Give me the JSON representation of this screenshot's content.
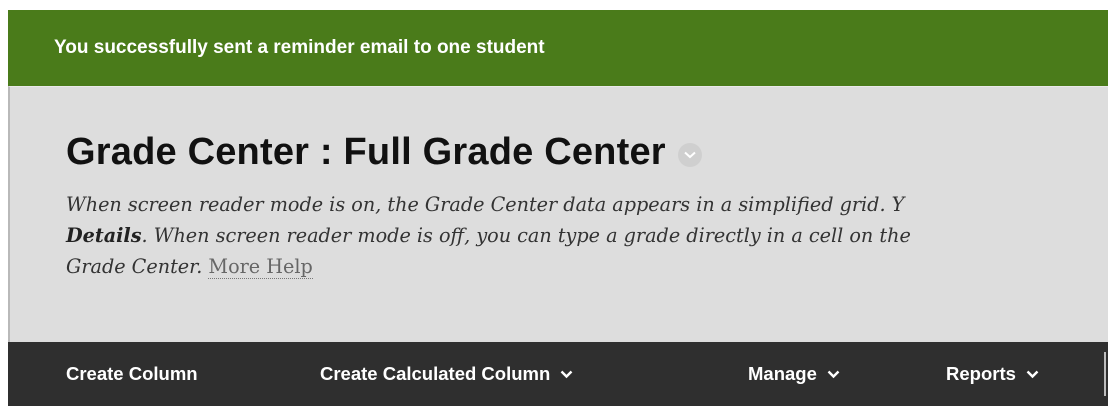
{
  "banner": {
    "message": "You successfully sent a reminder email to one student",
    "color": "#4a7b1a"
  },
  "header": {
    "title": "Grade Center : Full Grade Center",
    "title_menu_icon": "chevron-down-circle-icon",
    "help": {
      "line1": "When screen reader mode is on, the Grade Center data appears in a simplified grid. Y",
      "line2_bold": "Details",
      "line2_rest": ". When screen reader mode is off, you can type a grade directly in a cell on the",
      "line3": "Grade Center.",
      "more_help_link": "More Help"
    }
  },
  "toolbar": {
    "background": "#2f2f2f",
    "create_column": "Create Column",
    "create_calculated_column": "Create Calculated Column",
    "manage": "Manage",
    "reports": "Reports"
  }
}
